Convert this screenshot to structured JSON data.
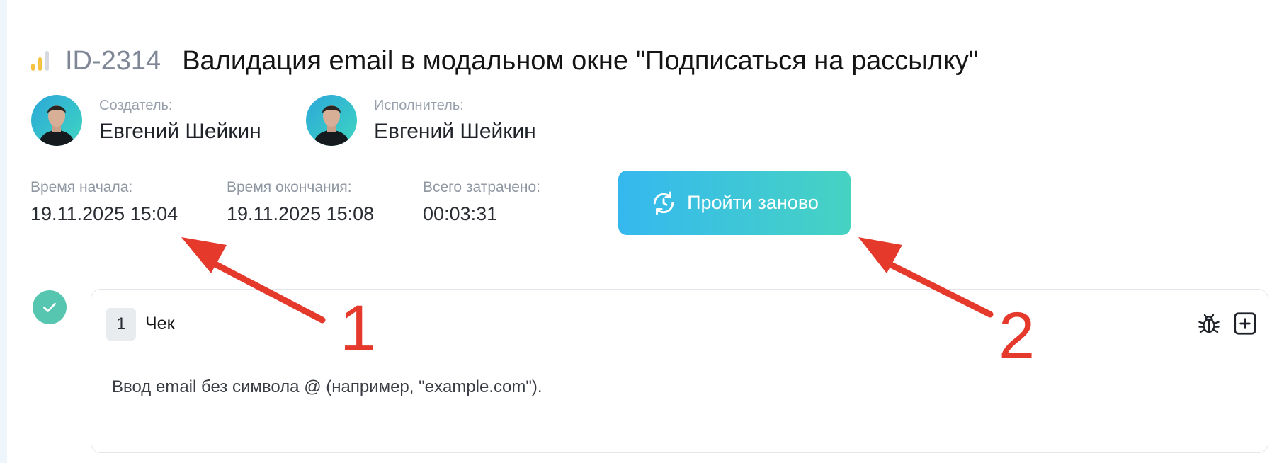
{
  "task": {
    "id": "ID-2314",
    "title": "Валидация email в модальном окне \"Подписаться на рассылку\"",
    "priority_icon": "priority-bars-icon"
  },
  "people": {
    "creator": {
      "role": "Создатель:",
      "name": "Евгений Шейкин"
    },
    "assignee": {
      "role": "Исполнитель:",
      "name": "Евгений Шейкин"
    }
  },
  "timing": {
    "start": {
      "label": "Время начала:",
      "value": "19.11.2025 15:04"
    },
    "end": {
      "label": "Время окончания:",
      "value": "19.11.2025 15:08"
    },
    "total": {
      "label": "Всего затрачено:",
      "value": "00:03:31"
    }
  },
  "actions": {
    "retry_label": "Пройти заново",
    "retry_icon": "refresh-icon"
  },
  "step": {
    "number": "1",
    "title": "Чек",
    "text": "Ввод email без символа @ (например, \"example.com\").",
    "status_icon": "check-icon",
    "bug_icon": "bug-icon",
    "add_icon": "add-square-icon"
  },
  "annotations": {
    "label_1": "1",
    "label_2": "2"
  },
  "colors": {
    "accent_gradient_start": "#35b8ef",
    "accent_gradient_end": "#46d3c2",
    "success": "#56c6b1",
    "annotation_red": "#e5392c",
    "priority_yellow": "#f5c242",
    "priority_grey": "#d6dae0"
  }
}
